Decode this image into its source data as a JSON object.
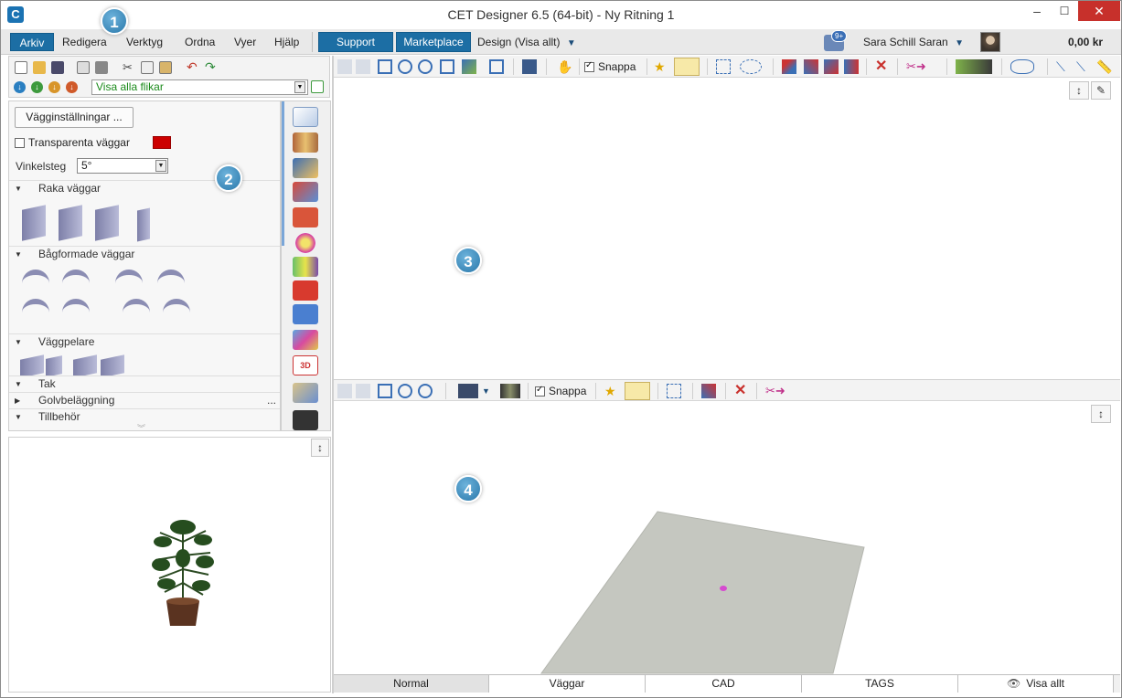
{
  "window": {
    "title": "CET Designer 6.5 (64-bit) - Ny Ritning 1",
    "minimize": "–",
    "maximize": "☐",
    "close": "✕"
  },
  "menu": {
    "items": [
      "Arkiv",
      "Redigera",
      "Verktyg",
      "Ordna",
      "Vyer",
      "Hjälp"
    ],
    "support": "Support",
    "marketplace": "Marketplace",
    "design_mode": "Design (Visa allt)",
    "notification_badge": "9+",
    "user_name": "Sara Schill Saran",
    "price": "0,00 kr"
  },
  "left_toolbar": {
    "tab_select": "Visa alla flikar"
  },
  "wall_panel": {
    "settings_button": "Vägginställningar ...",
    "transparent_label": "Transparenta väggar",
    "transparent_color": "#cc0000",
    "angle_label": "Vinkelsteg",
    "angle_value": "5°",
    "sections": {
      "straight": "Raka väggar",
      "curved": "Bågformade väggar",
      "pillars": "Väggpelare",
      "roof": "Tak",
      "floor": "Golvbeläggning",
      "floor_more": "...",
      "accessories": "Tillbehör"
    }
  },
  "view_toolbar_top": {
    "snap_label": "Snappa"
  },
  "view_toolbar_bottom": {
    "snap_label": "Snappa"
  },
  "bottom_tabs": [
    "Normal",
    "Väggar",
    "CAD",
    "TAGS",
    "Visa allt"
  ],
  "callouts": [
    "1",
    "2",
    "3",
    "4"
  ],
  "colors": {
    "accent": "#1c6ea4",
    "floor": "#c5c7c0"
  }
}
